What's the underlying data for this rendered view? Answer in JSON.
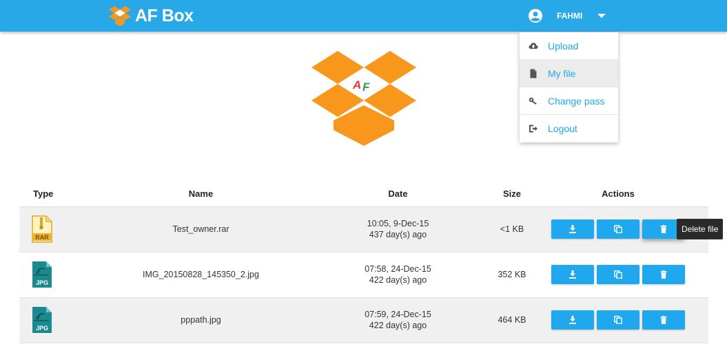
{
  "app": {
    "brand": "AF Box",
    "logo_letters": "AF"
  },
  "user": {
    "name": "FAHMI"
  },
  "menu": [
    {
      "label": "Upload",
      "icon": "cloud-upload-icon",
      "active": false
    },
    {
      "label": "My file",
      "icon": "file-icon",
      "active": true
    },
    {
      "label": "Change pass",
      "icon": "key-icon",
      "active": false
    },
    {
      "label": "Logout",
      "icon": "logout-icon",
      "active": false
    }
  ],
  "table": {
    "headers": {
      "type": "Type",
      "name": "Name",
      "date": "Date",
      "size": "Size",
      "actions": "Actions"
    },
    "rows": [
      {
        "type": "RAR",
        "name": "Test_owner.rar",
        "date": "10:05, 9-Dec-15",
        "ago": "437 day(s) ago",
        "size": "<1 KB"
      },
      {
        "type": "JPG",
        "name": "IMG_20150828_145350_2.jpg",
        "date": "07:58, 24-Dec-15",
        "ago": "422 day(s) ago",
        "size": "352 KB"
      },
      {
        "type": "JPG",
        "name": "pppath.jpg",
        "date": "07:59, 24-Dec-15",
        "ago": "422 day(s) ago",
        "size": "464 KB"
      }
    ]
  },
  "tooltip": "Delete file",
  "colors": {
    "primary": "#29a8e8",
    "button": "#1fa8ee",
    "logo": "#f7981d",
    "rar": "#f0b432",
    "jpg": "#1b8a8f"
  }
}
